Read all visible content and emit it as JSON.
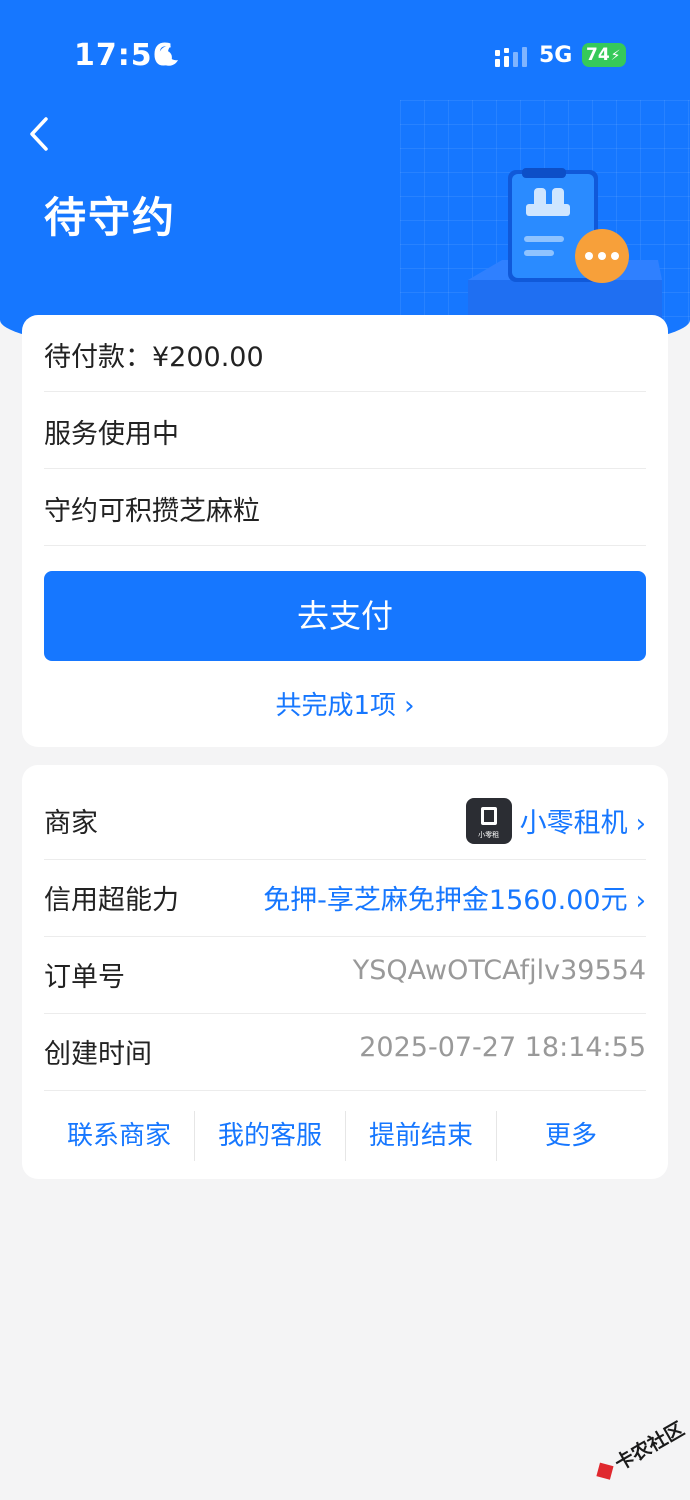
{
  "status_bar": {
    "time": "17:56",
    "network": "5G",
    "battery": "74"
  },
  "header": {
    "title": "待守约"
  },
  "summary": {
    "pending_payment": "待付款：¥200.00",
    "service_status": "服务使用中",
    "benefit": "守约可积攒芝麻粒",
    "pay_button": "去支付",
    "completed_link": "共完成1项"
  },
  "details": {
    "merchant_label": "商家",
    "merchant_name": "小零租机",
    "merchant_logo_text": "小零租",
    "credit_label": "信用超能力",
    "credit_value": "免押-享芝麻免押金1560.00元",
    "order_label": "订单号",
    "order_value": "YSQAwOTCAfjlv39554",
    "created_label": "创建时间",
    "created_value": "2025-07-27 18:14:55"
  },
  "actions": [
    "联系商家",
    "我的客服",
    "提前结束",
    "更多"
  ],
  "watermark": {
    "text": "卡农社区"
  },
  "colors": {
    "primary": "#1677ff",
    "background": "#f4f4f5",
    "orange_badge": "#f7a03a"
  }
}
